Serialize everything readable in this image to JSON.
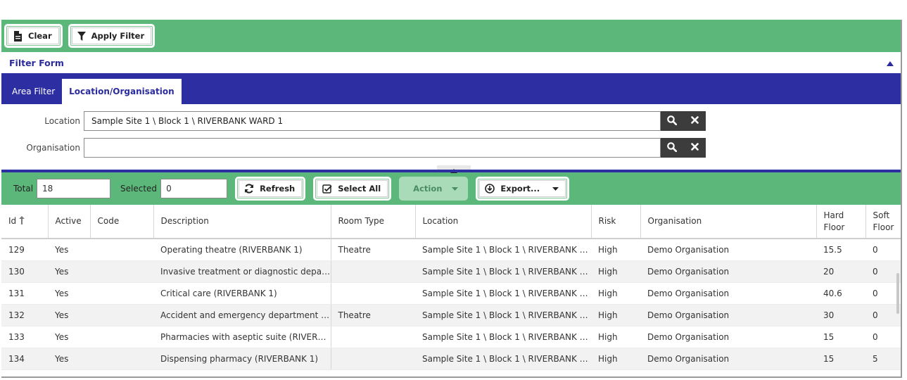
{
  "toolbar": {
    "clear_label": "Clear",
    "apply_filter_label": "Apply Filter"
  },
  "filter_form": {
    "title": "Filter Form",
    "tabs": [
      {
        "label": "Area Filter",
        "active": false
      },
      {
        "label": "Location/Organisation",
        "active": true
      }
    ],
    "location_label": "Location",
    "location_value": "Sample Site 1 \\ Block 1 \\ RIVERBANK WARD 1",
    "organisation_label": "Organisation",
    "organisation_value": ""
  },
  "grid_toolbar": {
    "total_label": "Total",
    "total_value": "18",
    "selected_label": "Selected",
    "selected_value": "0",
    "refresh_label": "Refresh",
    "select_all_label": "Select All",
    "action_label": "Action",
    "export_label": "Export..."
  },
  "table": {
    "columns": [
      "Id",
      "Active",
      "Code",
      "Description",
      "Room Type",
      "Location",
      "Risk",
      "Organisation",
      "Hard Floor",
      "Soft Floor"
    ],
    "rows": [
      [
        "129",
        "Yes",
        "",
        "Operating theatre (RIVERBANK 1)",
        "Theatre",
        "Sample Site 1 \\ Block 1 \\ RIVERBANK W...",
        "High",
        "Demo Organisation",
        "15.5",
        "0"
      ],
      [
        "130",
        "Yes",
        "",
        "Invasive treatment or diagnostic depart...",
        "",
        "Sample Site 1 \\ Block 1 \\ RIVERBANK W...",
        "High",
        "Demo Organisation",
        "20",
        "0"
      ],
      [
        "131",
        "Yes",
        "",
        "Critical care (RIVERBANK 1)",
        "",
        "Sample Site 1 \\ Block 1 \\ RIVERBANK W...",
        "High",
        "Demo Organisation",
        "40.6",
        "0"
      ],
      [
        "132",
        "Yes",
        "",
        "Accident and emergency department (...",
        "Theatre",
        "Sample Site 1 \\ Block 1 \\ RIVERBANK W...",
        "High",
        "Demo Organisation",
        "30",
        "0"
      ],
      [
        "133",
        "Yes",
        "",
        "Pharmacies with aseptic suite (RIVERBA...",
        "",
        "Sample Site 1 \\ Block 1 \\ RIVERBANK W...",
        "High",
        "Demo Organisation",
        "15",
        "0"
      ],
      [
        "134",
        "Yes",
        "",
        "Dispensing pharmacy (RIVERBANK 1)",
        "",
        "Sample Site 1 \\ Block 1 \\ RIVERBANK W...",
        "High",
        "Demo Organisation",
        "15",
        "5"
      ]
    ]
  },
  "colors": {
    "green_bar": "#5cb87a",
    "navy": "#2e2ea3",
    "icon_dark": "#3c3c3c"
  },
  "icons": [
    "file-icon",
    "filter-icon",
    "chevron-up-icon",
    "search-icon",
    "close-icon",
    "refresh-icon",
    "checkbox-icon",
    "caret-down-icon",
    "download-icon",
    "sort-asc-icon"
  ]
}
